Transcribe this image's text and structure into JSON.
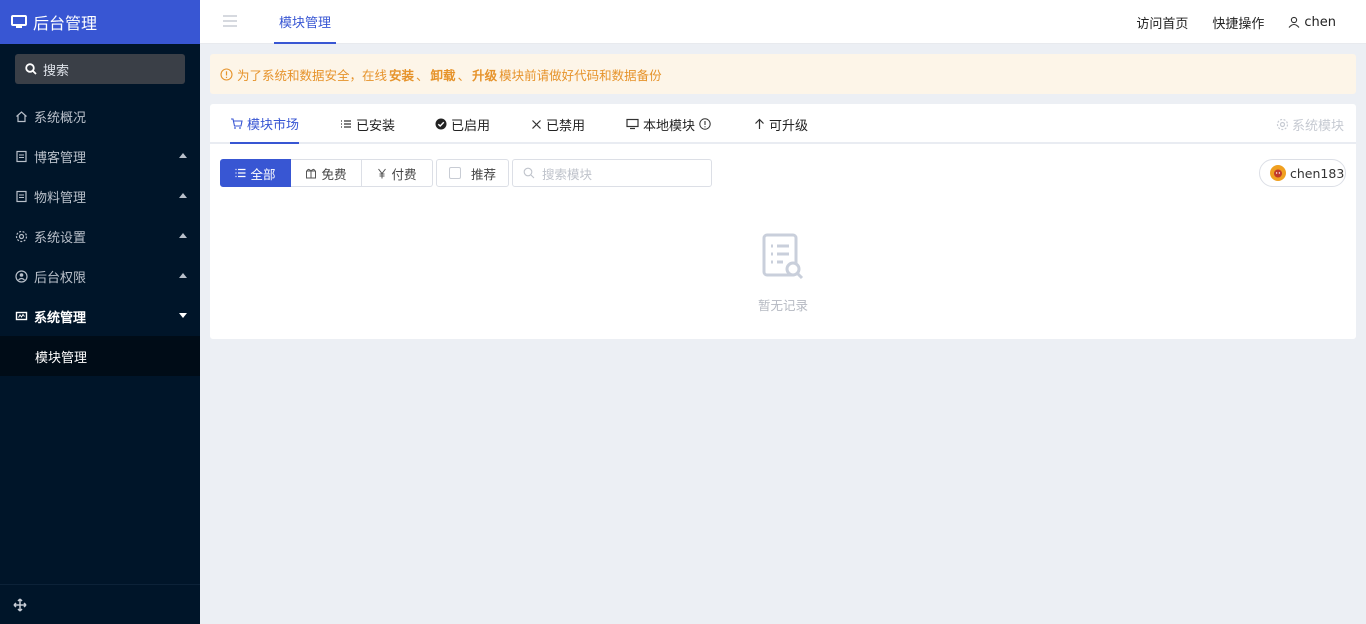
{
  "sidebar": {
    "brand": "后台管理",
    "search_label": "搜索",
    "items": [
      {
        "label": "系统概况",
        "icon": "home-icon"
      },
      {
        "label": "博客管理",
        "icon": "document-icon"
      },
      {
        "label": "物料管理",
        "icon": "document-icon"
      },
      {
        "label": "系统设置",
        "icon": "gear-icon"
      },
      {
        "label": "后台权限",
        "icon": "user-circle-icon"
      },
      {
        "label": "系统管理",
        "icon": "monitor-chart-icon"
      }
    ],
    "submenu_item": "模块管理"
  },
  "header": {
    "active_tab": "模块管理",
    "visit_home": "访问首页",
    "quick_ops": "快捷操作",
    "username": "chen"
  },
  "alert": {
    "prefix": "为了系统和数据安全，在线",
    "install": "安装",
    "sep1": "、",
    "uninstall": "卸载",
    "sep2": "、",
    "upgrade": "升级",
    "suffix": "模块前请做好代码和数据备份"
  },
  "tabs": [
    {
      "label": "模块市场"
    },
    {
      "label": "已安装"
    },
    {
      "label": "已启用"
    },
    {
      "label": "已禁用"
    },
    {
      "label": "本地模块"
    },
    {
      "label": "可升级"
    }
  ],
  "system_modules": "系统模块",
  "filters": {
    "all": "全部",
    "free": "免费",
    "paid": "付费",
    "recommend": "推荐",
    "search_placeholder": "搜索模块"
  },
  "account": "chen183",
  "empty_text": "暂无记录",
  "colors": {
    "brand": "#3856d3",
    "sidebar_bg": "#001529",
    "alert_text": "#e6932b",
    "alert_bg": "#fdf5e8"
  }
}
